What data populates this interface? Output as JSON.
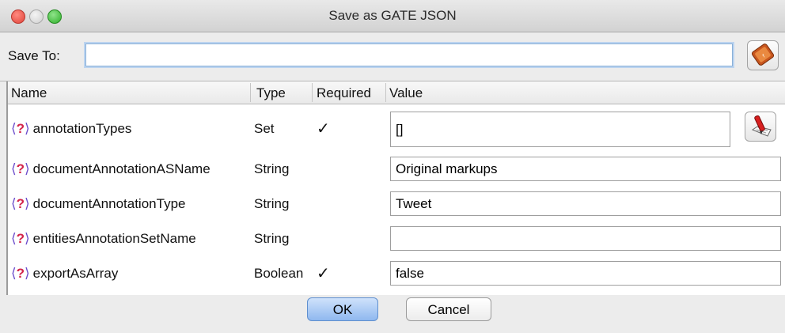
{
  "window": {
    "title": "Save as GATE JSON"
  },
  "saveto": {
    "label": "Save To:",
    "value": "",
    "browse_icon": "open-file-icon"
  },
  "table": {
    "headers": {
      "name": "Name",
      "type": "Type",
      "required": "Required",
      "value": "Value"
    },
    "rows": [
      {
        "name": "annotationTypes",
        "type": "Set",
        "required": "✓",
        "value": "[]"
      },
      {
        "name": "documentAnnotationASName",
        "type": "String",
        "required": "",
        "value": "Original markups"
      },
      {
        "name": "documentAnnotationType",
        "type": "String",
        "required": "",
        "value": "Tweet"
      },
      {
        "name": "entitiesAnnotationSetName",
        "type": "String",
        "required": "",
        "value": ""
      },
      {
        "name": "exportAsArray",
        "type": "Boolean",
        "required": "✓",
        "value": "false"
      }
    ]
  },
  "buttons": {
    "ok": "OK",
    "cancel": "Cancel"
  },
  "colors": {
    "accent": "#8fb8ef",
    "close": "#e0443a",
    "maximize": "#2fb02a"
  }
}
